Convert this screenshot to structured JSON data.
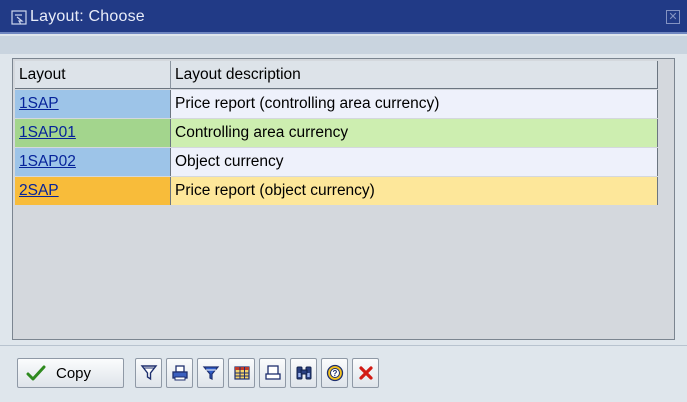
{
  "window": {
    "title": "Layout: Choose"
  },
  "table": {
    "columns": [
      "Layout",
      "Layout description"
    ],
    "rows": [
      {
        "layout": "1SAP",
        "description": "Price report (controlling area currency)"
      },
      {
        "layout": "1SAP01",
        "description": "Controlling area currency"
      },
      {
        "layout": "1SAP02",
        "description": "Object currency"
      },
      {
        "layout": "2SAP",
        "description": "Price report (object currency)"
      }
    ]
  },
  "toolbar": {
    "copy_label": "Copy",
    "icons": [
      "check-icon",
      "filter-icon",
      "print-icon",
      "sort-icon",
      "grid-icon",
      "print-preview-icon",
      "find-icon",
      "help-icon",
      "cancel-icon"
    ]
  },
  "colors": {
    "title_bar": "#213a86",
    "selected_row_key": "#f8bc3a",
    "selected_row_desc": "#fde79a",
    "link": "#06239a"
  }
}
